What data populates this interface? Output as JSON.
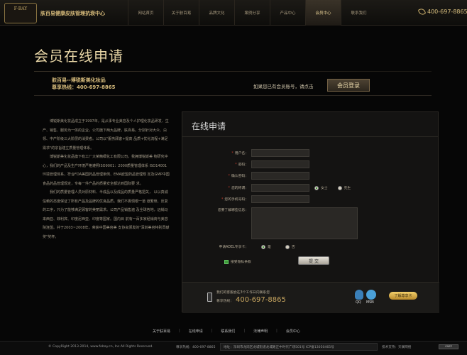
{
  "header": {
    "logo_text": "F·BAY",
    "brand": "肤百易健康皮肤管理抗衰中心",
    "nav": [
      "网站首页",
      "关于肤百易",
      "品牌文化",
      "案例分享",
      "产品中心",
      "会员中心",
      "联系我们"
    ],
    "active_index": 5,
    "hotline": "400-697-8865"
  },
  "hero": {
    "title": "会员在线申请",
    "company_line1": "肤百易--博锐斯美化妆品",
    "company_line2": "尊享热线：400-697-8865",
    "member_question": "如果您已有会员账号，请点击",
    "login_button": "会员登录"
  },
  "left_text": [
    "博锐斯美化妆品成立于1997年，是从事专业美容及个人护理化妆品研发、生产、销售、服务为一体的企业，公司旗下两大品牌，肤百易。分别针对大众、白领、中产阶级三大阶层的消费者。公司以\"服务顾客+提高 品质+优化流程+满足需求\"的宗旨建立质量管理体系。",
    "博锐斯美化妆品旗下有工厂大荣精细化工有限公司，我拥博锐斯美 物研究中心，我们的产品及生产环境严格遵照ISO9001：2000质量管理体系 ISO14001环境管理体系，符合FDA美国药品管理条例、EMA欧盟药品管理规 定及GMP中国食品药品管理规定，专每一件产品的质量安全都达到国际要 求。",
    "我们的质量管理人员对原材料、半成品以及成品的质量严格把关， 以以真诚信赖的态度保证了所有产品及品牌的优良品质。我们不畏惧艰一道 道繁琐、反复的工序，只为了能够满足顾客的美丽需求。公司产品销售遍 及全球各地，远销马来西亚、菲利宾、印度尼西亚、印度等国家。国内目 前有一百多家经销商与美容院连盟。并于2003~2008年，荣获中国美容美 支协会颁发的\"深圳美容特别贡献奖\"奖杯。"
  ],
  "form": {
    "title": "在线申请",
    "fields": {
      "username": "用户名：",
      "password": "密码：",
      "confirm": "确认密码：",
      "name": "您的称谓：",
      "mobile": "您的手机号码：",
      "info": "您要了解哪些信息："
    },
    "gender": [
      "女士",
      "先生"
    ],
    "sms_label": "申请ADEL专享卡：",
    "sms_options": [
      "是",
      "否"
    ],
    "agree": "接受隐私条款",
    "submit": "提 交",
    "cs_note": "我们的客服会在3个工作日内联系您",
    "cs_phone_label": "尊享热线：",
    "cs_phone": "400-697-8865",
    "qq": "QQ",
    "msn": "MSN",
    "more": "了解尊享卡"
  },
  "footer": {
    "links": [
      "关于肤百易",
      "在线申请",
      "联系我们",
      "法律声明",
      "会员中心"
    ],
    "copyright": "© CopyRight 2013-2014, www.fobay.cn, Inc.All Rights Reserved.",
    "hotline": "尊享热线：400-697-8865",
    "address": "地址：深圳市龙岗区龙城街道龙城路正中时代广场501号   ICP备13050465号",
    "tech": "技术支持：天联网络",
    "badge": "CNZZ"
  }
}
